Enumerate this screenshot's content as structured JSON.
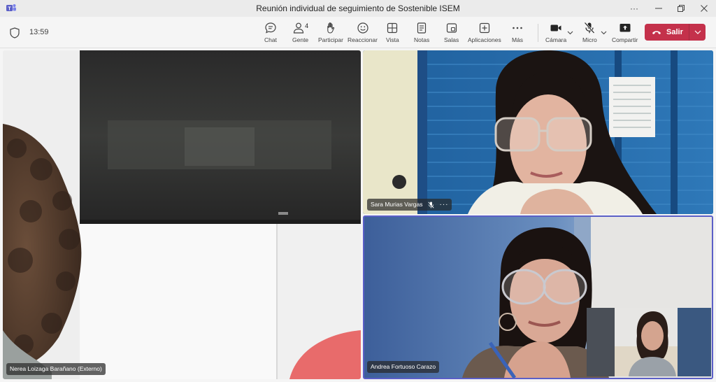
{
  "window": {
    "title": "Reunión individual de seguimiento de Sostenible ISEM",
    "more": "···"
  },
  "meeting": {
    "time": "13:59",
    "people_count": "4"
  },
  "toolbar": {
    "chat": "Chat",
    "people": "Gente",
    "raise": "Participar",
    "react": "Reaccionar",
    "view": "Vista",
    "notes": "Notas",
    "rooms": "Salas",
    "apps": "Aplicaciones",
    "more": "Más",
    "camera": "Cámara",
    "mic": "Micro",
    "share": "Compartir",
    "leave": "Salir"
  },
  "participants": [
    {
      "name": "Nerea Loizaga Barañano (Externo)"
    },
    {
      "name": "Sara Murias Vargas",
      "more": "···"
    },
    {
      "name": "Andrea Fortuoso Carazo"
    }
  ],
  "colors": {
    "leave_red": "#c4314b",
    "active_speaker_border": "#5b5fc7",
    "titlebar_bg": "#ebebeb",
    "toolbar_bg": "#f5f5f5"
  }
}
